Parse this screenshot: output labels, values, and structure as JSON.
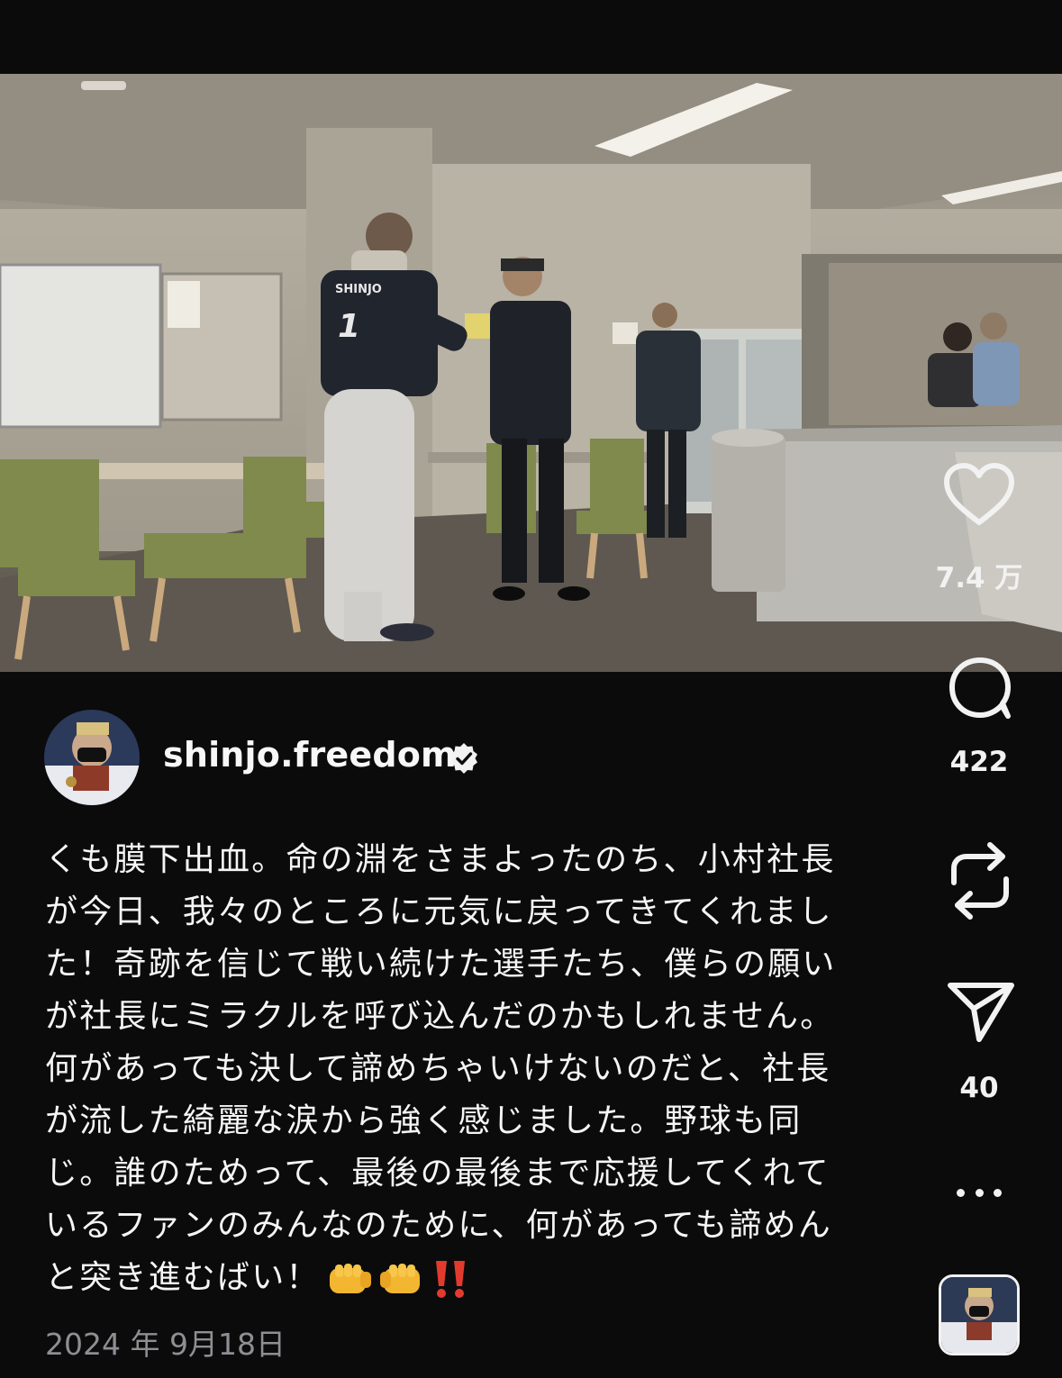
{
  "post": {
    "author": "shinjo.freedom",
    "caption_lines": [
      "くも膜下出血。命の淵をさまよったのち、小村社長",
      "が今日、我々のところに元気に戻ってきてくれまし",
      "た！奇跡を信じて戦い続けた選手たち、僕らの願い",
      "が社長にミラクルを呼び込んだのかもしれません。",
      "何があっても決して諦めちゃいけないのだと、社長",
      "が流した綺麗な涙から強く感じました。野球も同",
      "じ。誰のためって、最後の最後まで応援してくれて",
      "いるファンのみんなのために、何があっても諦めん",
      "と突き進むばい！"
    ],
    "caption_emojis": [
      "👊",
      "👊",
      "‼️"
    ],
    "date": "2024 年 9月18日"
  },
  "actions": {
    "likes": "7.4 万",
    "comments": "422",
    "reposts": "",
    "shares": "40"
  },
  "icons": {
    "like": "heart-icon",
    "comment": "comment-bubble-icon",
    "repost": "repost-icon",
    "share": "paper-plane-icon",
    "more": "more-icon",
    "verified": "verified-badge-icon"
  },
  "scene": {
    "jersey_name": "SHINJO",
    "jersey_number": "1"
  },
  "colors": {
    "background": "#0b0b0c",
    "text": "#f5f5f5",
    "muted": "#8e8e93"
  }
}
